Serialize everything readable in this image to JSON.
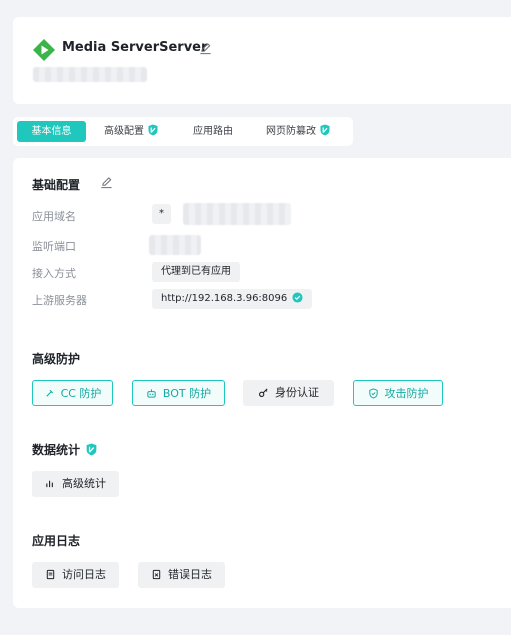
{
  "header": {
    "app_name": "Media ServerServer"
  },
  "tabs": [
    {
      "label": "基本信息",
      "active": true
    },
    {
      "label": "高级配置",
      "pro_badge": true
    },
    {
      "label": "应用路由"
    },
    {
      "label": "网页防篡改",
      "pro_badge": true
    }
  ],
  "basic_config": {
    "title": "基础配置",
    "domain_label": "应用域名",
    "domain_prefix": "*",
    "port_label": "监听端口",
    "access_label": "接入方式",
    "access_value": "代理到已有应用",
    "upstream_label": "上游服务器",
    "upstream_value": "http://192.168.3.96:8096"
  },
  "advanced_protection": {
    "title": "高级防护",
    "buttons": [
      "CC 防护",
      "BOT 防护",
      "身份认证",
      "攻击防护"
    ]
  },
  "statistics": {
    "title": "数据统计",
    "button": "高级统计"
  },
  "logs": {
    "title": "应用日志",
    "buttons": [
      "访问日志",
      "错误日志"
    ]
  },
  "colors": {
    "accent": "#1fc7bd",
    "background": "#f1f3f6",
    "card": "#ffffff"
  }
}
